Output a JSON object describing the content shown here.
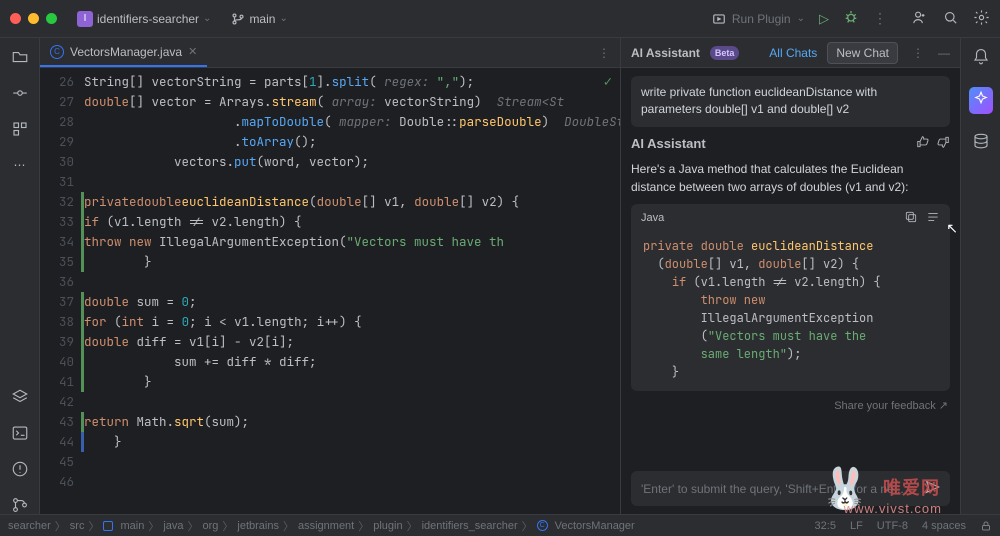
{
  "titlebar": {
    "project_name": "identifiers-searcher",
    "project_icon_letter": "I",
    "branch": "main",
    "run_config": "Run Plugin"
  },
  "tab": {
    "filename": "VectorsManager.java"
  },
  "editor": {
    "lines": [
      {
        "n": 26,
        "bar": "",
        "html": "            <span class='id'>String</span>[] vectorString = parts[<span class='num'>1</span>].<span class='mth'>split</span>(<span class='hint'> regex: </span><span class='str'>\",\"</span>);"
      },
      {
        "n": 27,
        "bar": "",
        "html": "            <span class='kw'>double</span>[] vector = <span class='id'>Arrays</span>.<span class='fn'>stream</span>(<span class='hint'> array: </span>vectorString)  <span class='hint'>Stream&lt;St</span>"
      },
      {
        "n": 28,
        "bar": "",
        "html": "                    .<span class='mth'>mapToDouble</span>(<span class='hint'> mapper: </span><span class='id'>Double</span>::<span class='fn'>parseDouble</span>)  <span class='hint'>DoubleStrea</span>"
      },
      {
        "n": 29,
        "bar": "",
        "html": "                    .<span class='mth'>toArray</span>();"
      },
      {
        "n": 30,
        "bar": "",
        "html": "            vectors.<span class='mth'>put</span>(word, vector);"
      },
      {
        "n": 31,
        "bar": "",
        "html": "    "
      },
      {
        "n": 32,
        "bar": "g",
        "html": "    <span class='kw'>private</span> <span class='kw'>double</span> <span class='fn'>euclideanDistance</span>(<span class='kw'>double</span>[] v1, <span class='kw'>double</span>[] v2) {"
      },
      {
        "n": 33,
        "bar": "g",
        "html": "        <span class='kw'>if</span> (v1.length != v2.length) {"
      },
      {
        "n": 34,
        "bar": "g",
        "html": "            <span class='kw'>throw new</span> IllegalArgumentException(<span class='str'>\"Vectors must have th</span>"
      },
      {
        "n": 35,
        "bar": "g",
        "html": "        }"
      },
      {
        "n": 36,
        "bar": "",
        "html": ""
      },
      {
        "n": 37,
        "bar": "g",
        "html": "        <span class='kw'>double</span> sum = <span class='num'>0</span>;"
      },
      {
        "n": 38,
        "bar": "g",
        "html": "        <span class='kw'>for</span> (<span class='kw'>int</span> i = <span class='num'>0</span>; i &lt; v1.length; i++) {"
      },
      {
        "n": 39,
        "bar": "g",
        "html": "            <span class='kw'>double</span> diff = v1[i] - v2[i];"
      },
      {
        "n": 40,
        "bar": "g",
        "html": "            sum += diff * diff;"
      },
      {
        "n": 41,
        "bar": "g",
        "html": "        }"
      },
      {
        "n": 42,
        "bar": "",
        "html": ""
      },
      {
        "n": 43,
        "bar": "g",
        "html": "        <span class='kw'>return</span> Math.<span class='fn'>sqrt</span>(sum);"
      },
      {
        "n": 44,
        "bar": "b",
        "html": "    }"
      },
      {
        "n": 45,
        "bar": "",
        "html": ""
      },
      {
        "n": 46,
        "bar": "",
        "html": ""
      }
    ]
  },
  "assistant": {
    "title": "AI Assistant",
    "badge": "Beta",
    "all_chats": "All Chats",
    "new_chat": "New Chat",
    "user_msg": "write private function euclideanDistance with parameters double[] v1 and double[] v2",
    "resp_title": "AI Assistant",
    "resp_text": "Here's a Java method that calculates the Euclidean distance between two arrays of doubles (v1 and v2):",
    "code_lang": "Java",
    "code_html": "<span class='kw'>private</span> <span class='kw'>double</span> <span class='fn'>euclideanDistance</span>\n  (<span class='kw'>double</span>[] v1, <span class='kw'>double</span>[] v2) {\n    <span class='kw'>if</span> (v1.length != v2.length) {\n        <span class='kw'>throw new</span>\n        IllegalArgumentException\n        (<span class='str'>\"Vectors must have the\n        same length\"</span>);\n    }",
    "feedback": "Share your feedback",
    "prompt_placeholder": "'Enter' to submit the query, 'Shift+Enter' for a ne..."
  },
  "breadcrumbs": [
    "searcher",
    "src",
    "main",
    "java",
    "org",
    "jetbrains",
    "assignment",
    "plugin",
    "identifiers_searcher",
    "VectorsManager"
  ],
  "status": {
    "pos": "32:5",
    "sep": "LF",
    "enc": "UTF-8",
    "indent": "4 spaces"
  },
  "watermark": "唯爱网",
  "watermark_url": "www.vivst.com"
}
